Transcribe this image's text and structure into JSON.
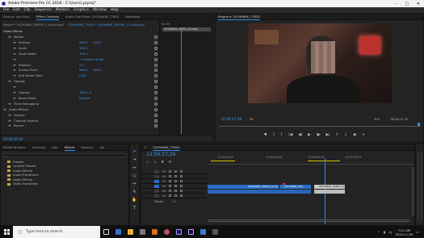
{
  "window": {
    "title": "Adobe Premiere Pro CC 2018 - C:\\Users\\.prproj*",
    "minimize": "–",
    "maximize": "□",
    "close": "✕"
  },
  "menu": [
    "File",
    "Edit",
    "Clip",
    "Sequence",
    "Markers",
    "Graphics",
    "Window",
    "Help"
  ],
  "source_tabs": [
    "Source: (no clips)",
    "Effect Controls",
    "Audio Clip Mixer: 20190606_77825",
    "Metadata"
  ],
  "effect_controls": {
    "breadcrumb_master": "Master * 20190606_160935_1 Scrub.mp4",
    "breadcrumb_sequence": "20190606_77825 * 20190606_160935_1 Scrub.mp4",
    "video_effects_label": "Video Effects",
    "mini_clip_name": "20190606_16303_1S.mp4",
    "mini_time": "00:00",
    "rows": [
      {
        "label": "Motion",
        "indent": 1,
        "value": "",
        "value2": ""
      },
      {
        "label": "Position",
        "indent": 2,
        "value": "960.0",
        "value2": "540.0"
      },
      {
        "label": "Scale",
        "indent": 2,
        "value": "100.0",
        "value2": ""
      },
      {
        "label": "Scale Width",
        "indent": 2,
        "value": "100.0",
        "value2": ""
      },
      {
        "label": "",
        "indent": 2,
        "value": "✓ Uniform Scale",
        "value2": ""
      },
      {
        "label": "Rotation",
        "indent": 2,
        "value": "0.0",
        "value2": ""
      },
      {
        "label": "Anchor Point",
        "indent": 2,
        "value": "960.0",
        "value2": "540.0"
      },
      {
        "label": "Anti-flicker Filter",
        "indent": 2,
        "value": "0.00",
        "value2": ""
      },
      {
        "label": "Opacity",
        "indent": 1,
        "value": "",
        "value2": ""
      },
      {
        "label": "",
        "indent": 2,
        "value": "",
        "value2": ""
      },
      {
        "label": "Opacity",
        "indent": 2,
        "value": "100.0 %",
        "value2": ""
      },
      {
        "label": "Blend Mode",
        "indent": 2,
        "value": "Normal",
        "value2": ""
      },
      {
        "label": "Time Remapping",
        "indent": 1,
        "value": "",
        "value2": ""
      },
      {
        "label": "Audio Effects",
        "indent": 0,
        "value": "",
        "value2": ""
      },
      {
        "label": "Volume",
        "indent": 1,
        "value": "",
        "value2": ""
      },
      {
        "label": "Channel Volume",
        "indent": 1,
        "value": "",
        "value2": ""
      },
      {
        "label": "Panner",
        "indent": 1,
        "value": "",
        "value2": ""
      }
    ],
    "timecode": "00:00:00:00"
  },
  "program": {
    "title": "Program: 20190606_77825",
    "timecode": "12;56;27;26",
    "fit": "Fit",
    "quality": "Full",
    "duration": "00;04;11;10"
  },
  "project_tabs": [
    "Media Browser",
    "Libraries",
    "Info",
    "Effects",
    "Markers",
    "His"
  ],
  "effects_tree": [
    "Presets",
    "Lumetri Presets",
    "Audio Effects",
    "Audio Transitions",
    "Video Effects",
    "Video Transitions"
  ],
  "timeline": {
    "title": "20190606_77825",
    "timecode": "12;56;27;26",
    "ruler": [
      "12;55;59;25",
      "12;56;29;29",
      "12;56;59;29",
      "12;57;29;29"
    ],
    "video_tracks": [
      "V3",
      "V2",
      "V1"
    ],
    "audio_tracks": [
      "A1",
      "A2",
      "A3"
    ],
    "master_label": "Master",
    "master_value": "0.0",
    "clip_v1_a": "20190606_16303_1S.mp4 [V]",
    "clip_v1_b": "20190606_16303",
    "clip_v1_c": "20190606_16303_1S",
    "clip_a1_a": "",
    "clip_a1_c": ""
  },
  "taskbar": {
    "search_placeholder": "Type here to search",
    "time": "7:21 AM",
    "date": "2019-11-09"
  },
  "colors": {
    "accent": "#2d8ceb",
    "value_blue": "#3f9cf0",
    "clip_blue": "#2c6fc7",
    "work_yellow": "#d9c100"
  }
}
